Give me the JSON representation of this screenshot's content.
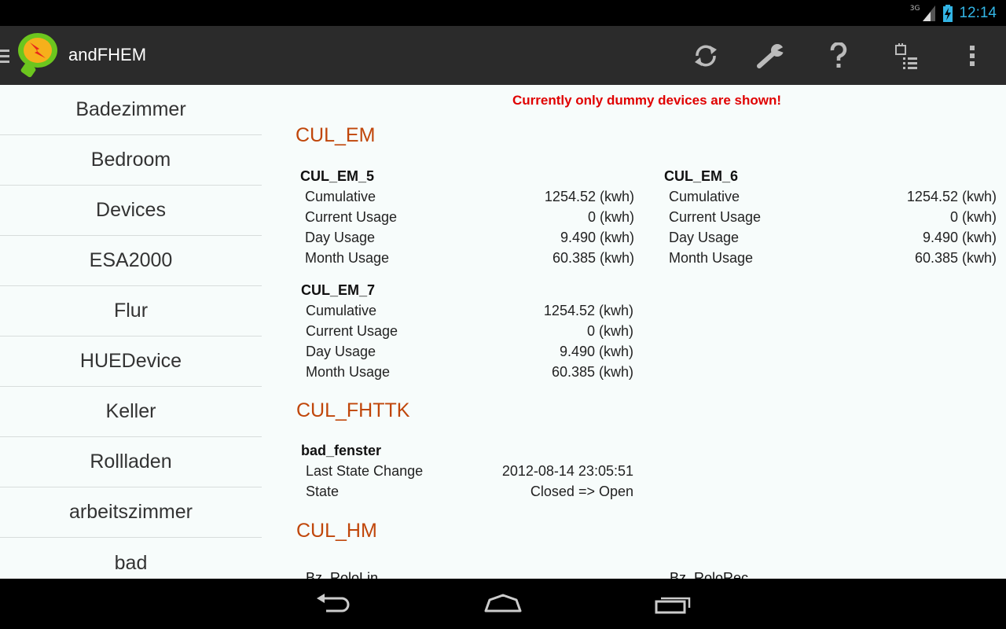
{
  "status_bar": {
    "network": "3G",
    "time": "12:14",
    "accent_color": "#33b5e5"
  },
  "action_bar": {
    "title": "andFHEM",
    "icons": [
      "refresh-icon",
      "wrench-icon",
      "help-icon",
      "timer-list-icon",
      "overflow-menu-icon"
    ]
  },
  "sidebar": {
    "items": [
      {
        "label": "Badezimmer"
      },
      {
        "label": "Bedroom"
      },
      {
        "label": "Devices"
      },
      {
        "label": "ESA2000"
      },
      {
        "label": "Flur"
      },
      {
        "label": "HUEDevice"
      },
      {
        "label": "Keller"
      },
      {
        "label": "Rollladen"
      },
      {
        "label": "arbeitszimmer"
      },
      {
        "label": "bad"
      }
    ]
  },
  "main": {
    "notice": "Currently only dummy devices are shown!",
    "sections": {
      "cul_em": {
        "title": "CUL_EM",
        "devices": [
          {
            "name": "CUL_EM_5",
            "rows": [
              {
                "label": "Cumulative",
                "value": "1254.52 (kwh)"
              },
              {
                "label": "Current Usage",
                "value": "0 (kwh)"
              },
              {
                "label": "Day Usage",
                "value": "9.490 (kwh)"
              },
              {
                "label": "Month Usage",
                "value": "60.385 (kwh)"
              }
            ]
          },
          {
            "name": "CUL_EM_6",
            "rows": [
              {
                "label": "Cumulative",
                "value": "1254.52 (kwh)"
              },
              {
                "label": "Current Usage",
                "value": "0 (kwh)"
              },
              {
                "label": "Day Usage",
                "value": "9.490 (kwh)"
              },
              {
                "label": "Month Usage",
                "value": "60.385 (kwh)"
              }
            ]
          },
          {
            "name": "CUL_EM_7",
            "rows": [
              {
                "label": "Cumulative",
                "value": "1254.52 (kwh)"
              },
              {
                "label": "Current Usage",
                "value": "0 (kwh)"
              },
              {
                "label": "Day Usage",
                "value": "9.490 (kwh)"
              },
              {
                "label": "Month Usage",
                "value": "60.385 (kwh)"
              }
            ]
          }
        ]
      },
      "cul_fhttk": {
        "title": "CUL_FHTTK",
        "devices": [
          {
            "name": "bad_fenster",
            "rows": [
              {
                "label": "Last State Change",
                "value": "2012-08-14 23:05:51"
              },
              {
                "label": "State",
                "value": "Closed => Open"
              }
            ]
          }
        ]
      },
      "cul_hm": {
        "title": "CUL_HM",
        "devices": [
          {
            "name": "Bz_RoloLin"
          },
          {
            "name": "Bz_RoloRec"
          }
        ]
      }
    }
  },
  "nav_bar": {
    "buttons": [
      "back-icon",
      "home-icon",
      "recent-apps-icon"
    ]
  }
}
